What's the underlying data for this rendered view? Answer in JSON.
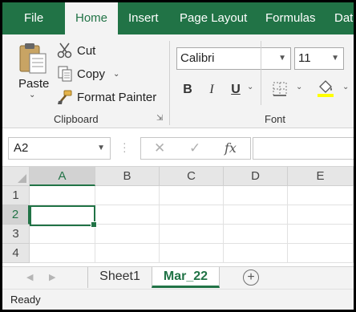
{
  "ribbon_tabs": [
    "File",
    "Home",
    "Insert",
    "Page Layout",
    "Formulas",
    "Dat"
  ],
  "active_tab": "Home",
  "clipboard": {
    "paste_label": "Paste",
    "cut_label": "Cut",
    "copy_label": "Copy",
    "format_painter_label": "Format Painter",
    "group_label": "Clipboard"
  },
  "font": {
    "font_name": "Calibri",
    "font_size": "11",
    "bold": "B",
    "italic": "I",
    "underline": "U",
    "group_label": "Font"
  },
  "formula_bar": {
    "name_box": "A2",
    "fx_label": "fx",
    "cancel_symbol": "✕",
    "enter_symbol": "✓",
    "content": ""
  },
  "grid": {
    "columns": [
      "A",
      "B",
      "C",
      "D",
      "E"
    ],
    "rows": [
      "1",
      "2",
      "3",
      "4"
    ],
    "selected_column": "A",
    "selected_row": "2"
  },
  "sheets": {
    "tabs": [
      "Sheet1",
      "Mar_22"
    ],
    "active": "Mar_22",
    "add_symbol": "+"
  },
  "status_bar": {
    "text": "Ready"
  },
  "colors": {
    "accent": "#217346",
    "highlight": "#FFFF00"
  },
  "icons": [
    "paste-icon",
    "scissors-icon",
    "copy-icon",
    "paintbrush-icon",
    "borders-icon",
    "fill-color-icon",
    "add-sheet-icon"
  ]
}
